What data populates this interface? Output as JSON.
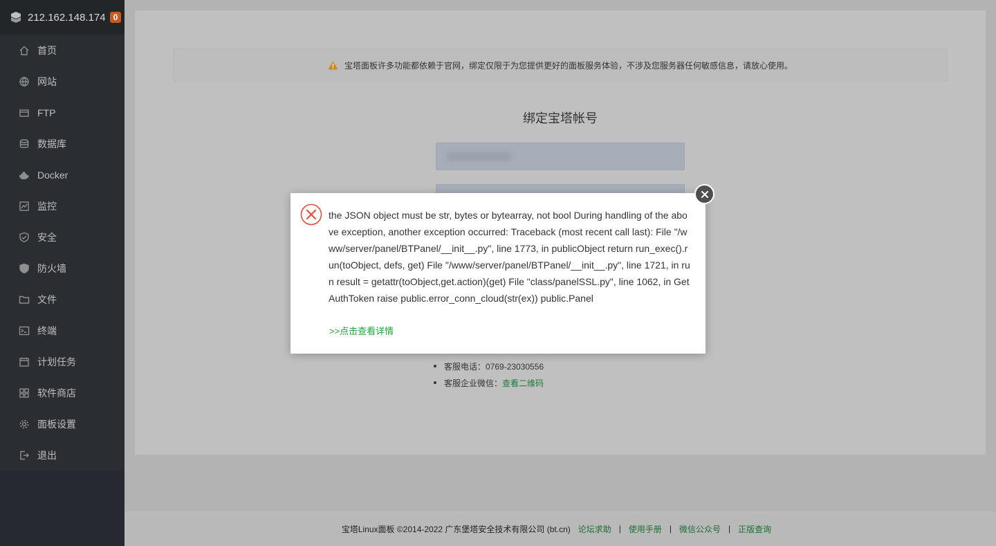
{
  "sidebar": {
    "server_ip": "212.162.148.174",
    "badge_count": "0",
    "items": [
      {
        "label": "首页",
        "icon": "home-icon"
      },
      {
        "label": "网站",
        "icon": "globe-icon"
      },
      {
        "label": "FTP",
        "icon": "ftp-icon"
      },
      {
        "label": "数据库",
        "icon": "database-icon"
      },
      {
        "label": "Docker",
        "icon": "docker-icon"
      },
      {
        "label": "监控",
        "icon": "monitor-icon"
      },
      {
        "label": "安全",
        "icon": "shield-check-icon"
      },
      {
        "label": "防火墙",
        "icon": "firewall-shield-icon"
      },
      {
        "label": "文件",
        "icon": "folder-icon"
      },
      {
        "label": "终端",
        "icon": "terminal-icon"
      },
      {
        "label": "计划任务",
        "icon": "calendar-icon"
      },
      {
        "label": "软件商店",
        "icon": "grid-icon"
      },
      {
        "label": "面板设置",
        "icon": "gear-icon"
      },
      {
        "label": "退出",
        "icon": "logout-icon"
      }
    ]
  },
  "main": {
    "notice": "宝塔面板许多功能都依赖于官网，绑定仅限于为您提供更好的面板服务体验，不涉及您服务器任何敏感信息，请放心使用。",
    "bind_title": "绑定宝塔帐号",
    "contact": {
      "phone": "客服电话：0769-23030556",
      "wechat_label": "客服企业微信：",
      "wechat_link": "查看二维码"
    }
  },
  "dialog": {
    "message": "the JSON object must be str, bytes or bytearray, not bool During handling of the above exception, another exception occurred: Traceback (most recent call last): File \"/www/server/panel/BTPanel/__init__.py\", line 1773, in publicObject return run_exec().run(toObject, defs, get) File \"/www/server/panel/BTPanel/__init__.py\", line 1721, in run result = getattr(toObject,get.action)(get) File \"class/panelSSL.py\", line 1062, in GetAuthToken raise public.error_conn_cloud(str(ex)) public.Panel",
    "detail_link": ">>点击查看详情"
  },
  "footer": {
    "copyright": "宝塔Linux面板 ©2014-2022 广东堡塔安全技术有限公司 (bt.cn)",
    "links": [
      "论坛求助",
      "使用手册",
      "微信公众号",
      "正版查询"
    ],
    "separator": "|"
  },
  "colors": {
    "sidebar_bg": "#2a2d31",
    "accent_green": "#20a53a",
    "badge_orange": "#c85a27",
    "error_red": "#e74c3c",
    "warning_orange": "#e8a33c"
  }
}
